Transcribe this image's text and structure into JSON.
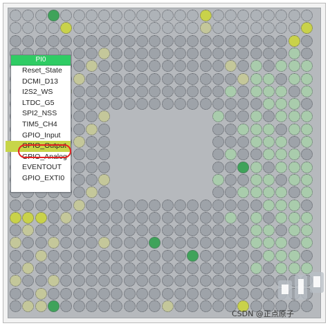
{
  "pin_menu": {
    "header": "PI0",
    "items": [
      {
        "label": "Reset_State",
        "selected": false
      },
      {
        "label": "DCMI_D13",
        "selected": false
      },
      {
        "label": "I2S2_WS",
        "selected": false
      },
      {
        "label": "LTDC_G5",
        "selected": false
      },
      {
        "label": "SPI2_NSS",
        "selected": false
      },
      {
        "label": "TIM5_CH4",
        "selected": false
      },
      {
        "label": "GPIO_Input",
        "selected": false
      },
      {
        "label": "GPIO_Output",
        "selected": true
      },
      {
        "label": "GPIO_Analog",
        "selected": false
      },
      {
        "label": "EVENTOUT",
        "selected": false
      },
      {
        "label": "GPIO_EXTI0",
        "selected": false
      }
    ]
  },
  "watermark": {
    "text": "CSDN @正点原子"
  },
  "colors": {
    "board": "#b6b9bd",
    "pin_gray": "#9ea3a9",
    "pin_light": "#aeb3b8",
    "pin_khaki": "#c4c79a",
    "pin_pale_green": "#a9ccac",
    "pin_yellow_green": "#c9d24a",
    "pin_green": "#3fa35a",
    "menu_header": "#2fcc64",
    "menu_selected": "#c7d548",
    "highlight_ring": "#e52222"
  }
}
